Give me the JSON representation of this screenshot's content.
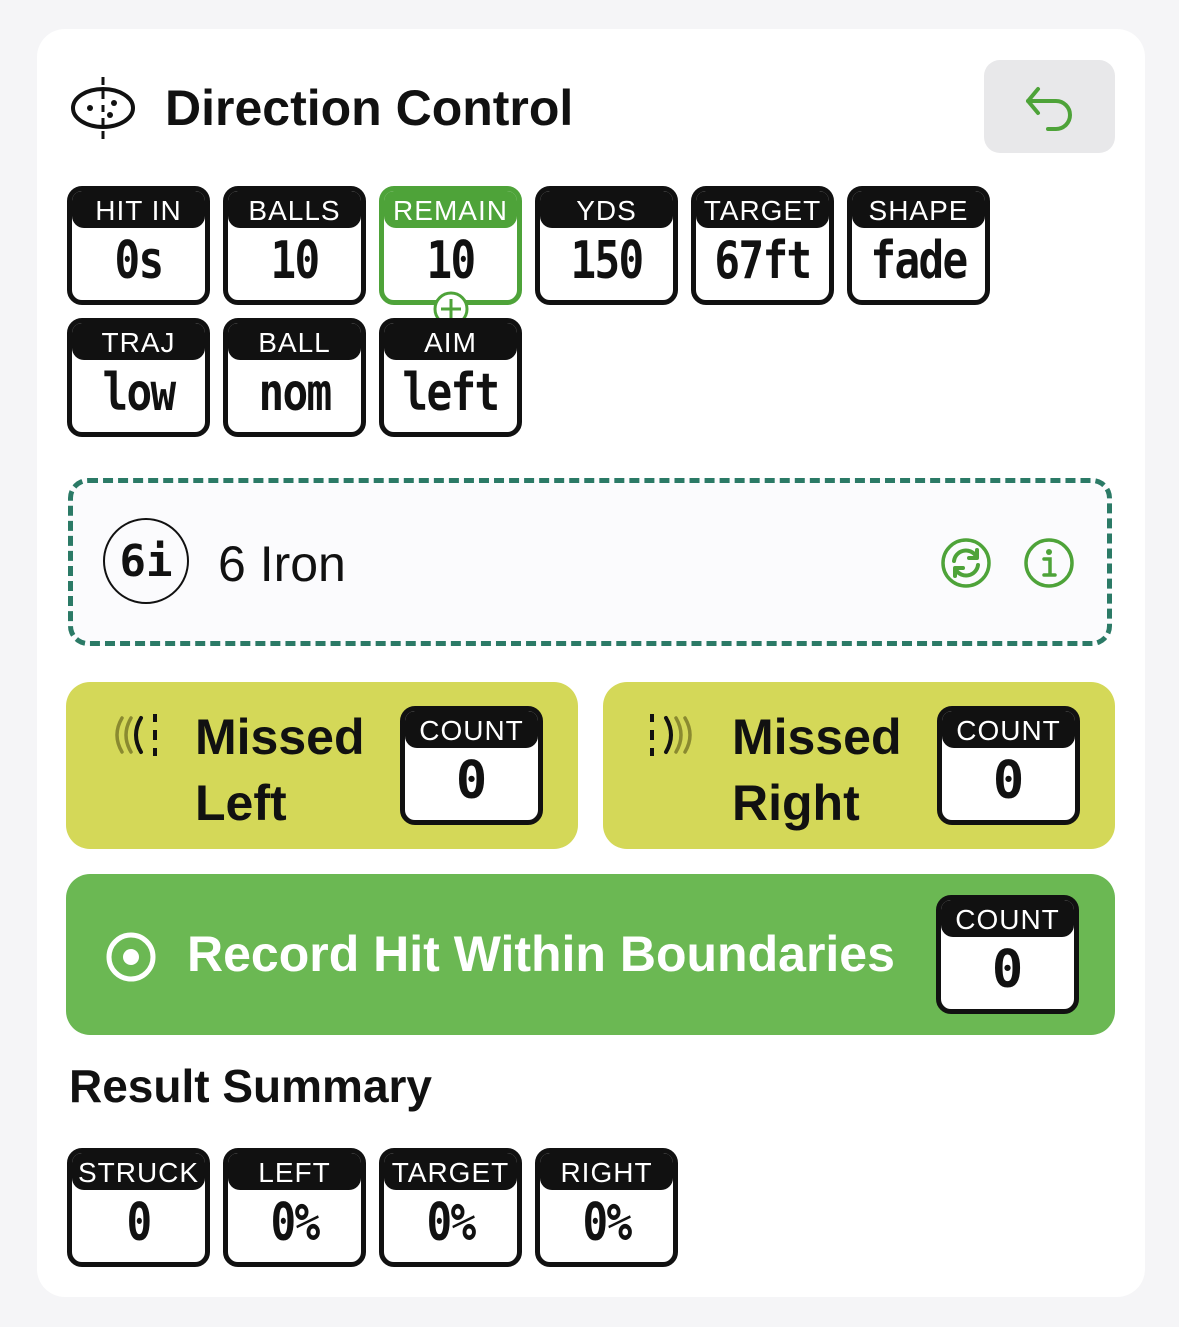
{
  "header": {
    "title": "Direction Control",
    "back_icon": "undo-arrow-icon"
  },
  "stats_row1": [
    {
      "label": "HIT IN",
      "value": "0s"
    },
    {
      "label": "BALLS",
      "value": "10"
    },
    {
      "label": "REMAIN",
      "value": "10"
    },
    {
      "label": "YDS",
      "value": "150"
    },
    {
      "label": "TARGET",
      "value": "67ft"
    },
    {
      "label": "SHAPE",
      "value": "fade"
    }
  ],
  "stats_row2": [
    {
      "label": "TRAJ",
      "value": "low"
    },
    {
      "label": "BALL",
      "value": "nom"
    },
    {
      "label": "AIM",
      "value": "left"
    }
  ],
  "club": {
    "badge": "6i",
    "name": "6 Iron"
  },
  "missed_left": {
    "label_line1": "Missed",
    "label_line2": "Left",
    "count_label": "COUNT",
    "count": "0"
  },
  "missed_right": {
    "label_line1": "Missed",
    "label_line2": "Right",
    "count_label": "COUNT",
    "count": "0"
  },
  "record": {
    "label": "Record Hit Within Boundaries",
    "count_label": "COUNT",
    "count": "0"
  },
  "summary": {
    "title": "Result Summary",
    "tiles": [
      {
        "label": "STRUCK",
        "value": "0"
      },
      {
        "label": "LEFT",
        "value": "0%"
      },
      {
        "label": "TARGET",
        "value": "0%"
      },
      {
        "label": "RIGHT",
        "value": "0%"
      }
    ]
  },
  "colors": {
    "accent_green": "#4ea339",
    "dashed_border": "#2b7a66",
    "missed_bg": "#d4d858",
    "record_bg": "#6bb853"
  }
}
